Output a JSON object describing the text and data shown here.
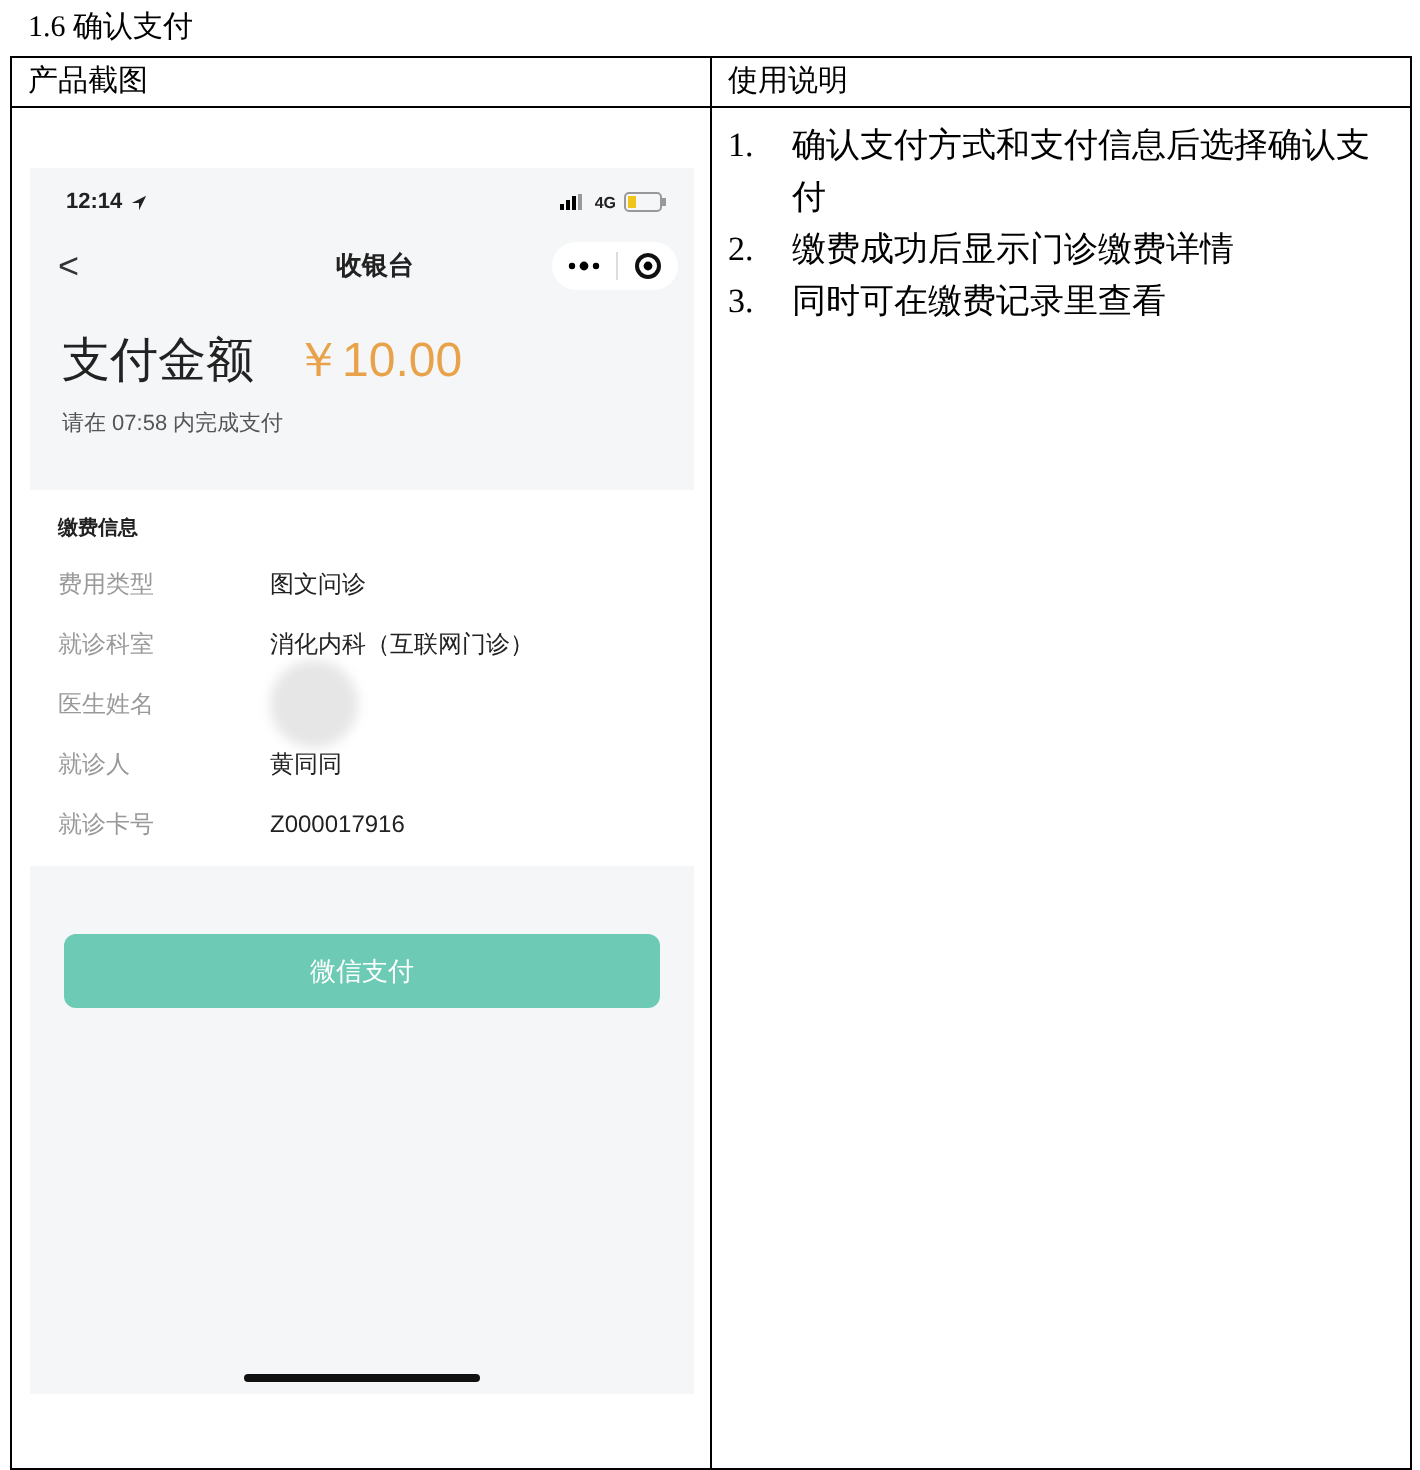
{
  "section_title": "1.6 确认支付",
  "table": {
    "columns": [
      "产品截图",
      "使用说明"
    ],
    "phone": {
      "status_bar": {
        "time": "12:14",
        "network": "4G"
      },
      "nav": {
        "back": "<",
        "title": "收银台"
      },
      "amount": {
        "label": "支付金额",
        "value": "￥10.00",
        "deadline": "请在 07:58 内完成支付"
      },
      "info": {
        "heading": "缴费信息",
        "rows": [
          {
            "label": "费用类型",
            "value": "图文问诊",
            "redacted": false
          },
          {
            "label": "就诊科室",
            "value": "消化内科（互联网门诊）",
            "redacted": false
          },
          {
            "label": "医生姓名",
            "redacted": true
          },
          {
            "label": "就诊人",
            "value": "黄同同",
            "redacted": false
          },
          {
            "label": "就诊卡号",
            "value": "Z000017916",
            "redacted": false
          }
        ]
      },
      "pay_button": "微信支付"
    },
    "notes": [
      {
        "number": "1.",
        "text": "确认支付方式和支付信息后选择确认支付"
      },
      {
        "number": "2.",
        "text": "缴费成功后显示门诊缴费详情"
      },
      {
        "number": "3.",
        "text": "同时可在缴费记录里查看"
      }
    ]
  }
}
